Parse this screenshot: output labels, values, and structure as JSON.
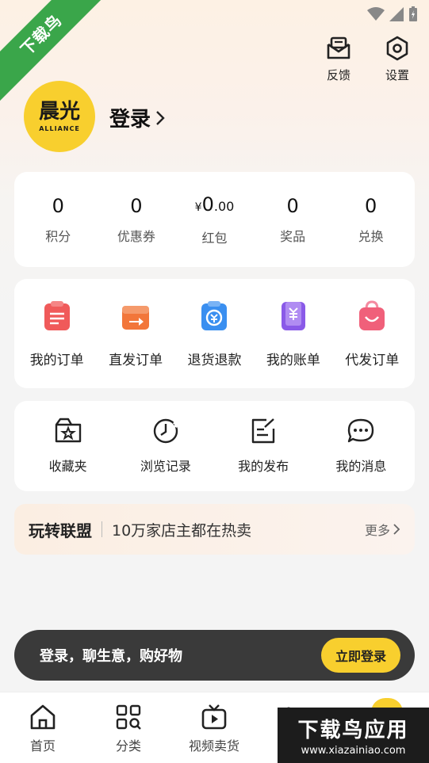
{
  "ribbon": {
    "text": "下载鸟"
  },
  "header": {
    "feedback_label": "反馈",
    "settings_label": "设置"
  },
  "profile": {
    "logo_main": "晨光",
    "logo_sub": "ALLIANCE",
    "login_label": "登录"
  },
  "stats": [
    {
      "value": "0",
      "label": "积分"
    },
    {
      "value": "0",
      "label": "优惠券"
    },
    {
      "currency": "¥",
      "value_int": "0",
      "value_dec": ".00",
      "label": "红包"
    },
    {
      "value": "0",
      "label": "奖品"
    },
    {
      "value": "0",
      "label": "兑换"
    }
  ],
  "orders": [
    {
      "label": "我的订单",
      "icon": "order-list-icon",
      "color": "#f05a5a"
    },
    {
      "label": "直发订单",
      "icon": "direct-ship-icon",
      "color": "#f2763a"
    },
    {
      "label": "退货退款",
      "icon": "refund-icon",
      "color": "#3a8ff0"
    },
    {
      "label": "我的账单",
      "icon": "bill-icon",
      "color": "#8a5ae8"
    },
    {
      "label": "代发订单",
      "icon": "dropship-bag-icon",
      "color": "#f0607a"
    }
  ],
  "tools": [
    {
      "label": "收藏夹",
      "icon": "favorites-folder-icon"
    },
    {
      "label": "浏览记录",
      "icon": "history-clock-icon"
    },
    {
      "label": "我的发布",
      "icon": "my-posts-icon"
    },
    {
      "label": "我的消息",
      "icon": "message-bubble-icon"
    }
  ],
  "promo": {
    "brand": "玩转联盟",
    "slogan": "10万家店主都在热卖",
    "more": "更多"
  },
  "login_bar": {
    "text": "登录，聊生意，购好物",
    "button": "立即登录"
  },
  "tabbar": [
    {
      "label": "首页",
      "icon": "home-icon"
    },
    {
      "label": "分类",
      "icon": "category-icon"
    },
    {
      "label": "视频卖货",
      "icon": "video-tv-icon"
    }
  ],
  "watermark": {
    "title": "下载鸟应用",
    "url": "www.xiazainiao.com"
  },
  "colors": {
    "accent_yellow": "#f8cf2e",
    "ribbon_green": "#3aa64a",
    "dark_bar": "#3a3a3a"
  }
}
